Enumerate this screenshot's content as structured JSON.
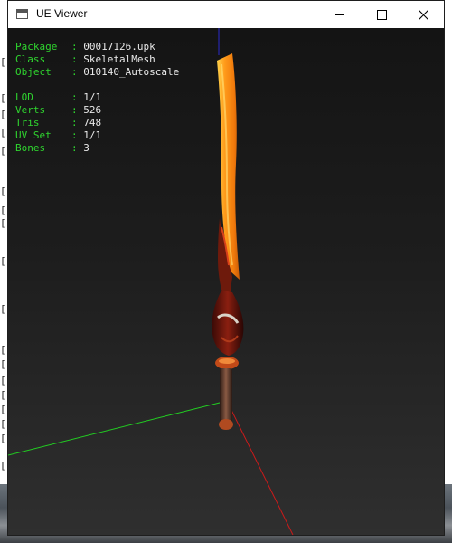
{
  "window": {
    "title": "UE Viewer"
  },
  "info": {
    "package_label": "Package",
    "package_value": "00017126.upk",
    "class_label": "Class",
    "class_value": "SkeletalMesh",
    "object_label": "Object",
    "object_value": "010140_Autoscale",
    "lod_label": "LOD",
    "lod_value": "1/1",
    "verts_label": "Verts",
    "verts_value": "526",
    "tris_label": "Tris",
    "tris_value": "748",
    "uvset_label": "UV Set",
    "uvset_value": "1/1",
    "bones_label": "Bones",
    "bones_value": "3",
    "separator": ":"
  },
  "colors": {
    "label_green": "#2fd42f",
    "value_white": "#e9e9e9",
    "axis_x": "#cc1a1a",
    "axis_y": "#22cc22",
    "axis_z": "#2a2acc"
  },
  "icons": {
    "app": "window-icon",
    "minimize": "minimize-icon",
    "maximize": "maximize-icon",
    "close": "close-icon"
  }
}
